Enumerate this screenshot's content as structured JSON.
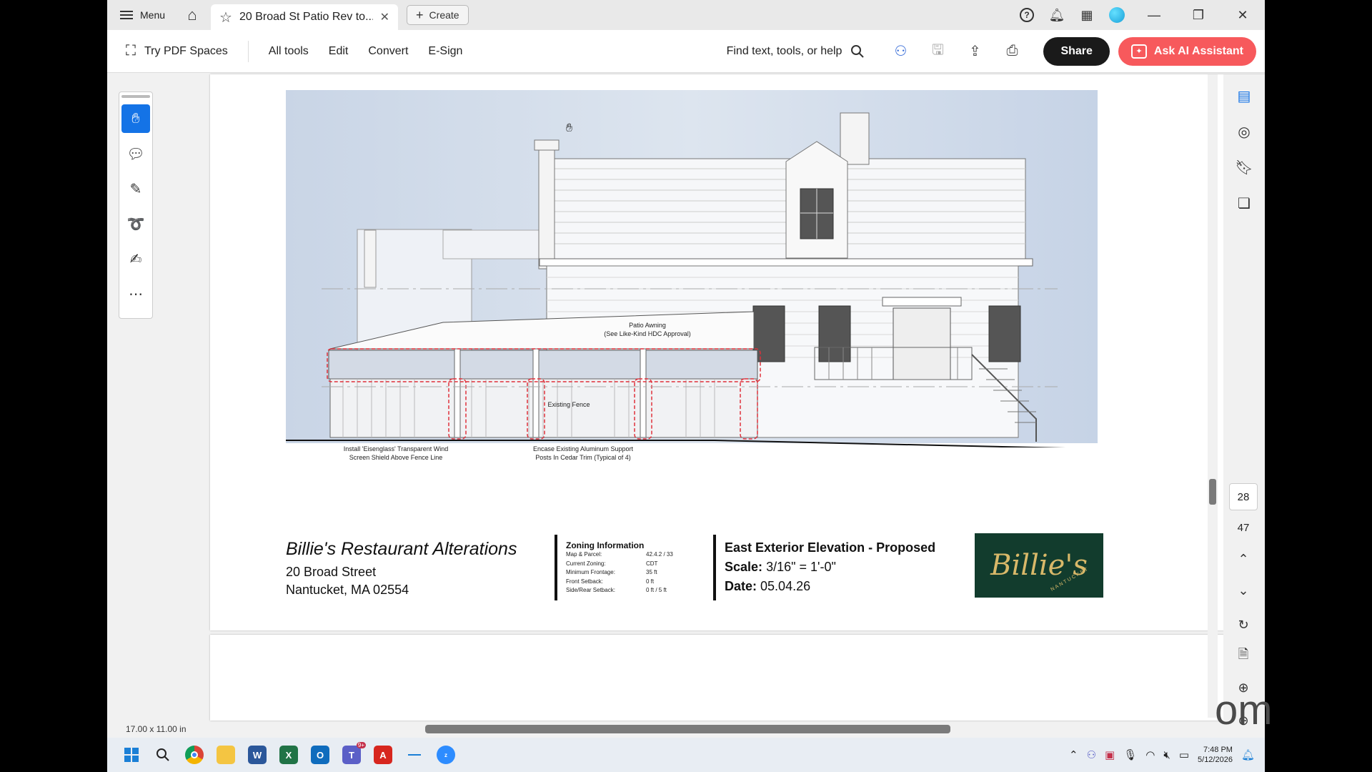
{
  "titlebar": {
    "menu_label": "Menu",
    "tab_title": "20 Broad St Patio Rev to...",
    "create_label": "Create"
  },
  "toolbar": {
    "try_pdf_spaces": "Try PDF Spaces",
    "menu": [
      "All tools",
      "Edit",
      "Convert",
      "E-Sign"
    ],
    "find_label": "Find text, tools, or help",
    "share_label": "Share",
    "ai_label": "Ask AI Assistant"
  },
  "drawing": {
    "label_awning_1": "Patio Awning",
    "label_awning_2": "(See Like-Kind HDC Approval)",
    "label_fence": "Existing Fence",
    "label_shield_1": "Install 'Eisenglass' Transparent Wind",
    "label_shield_2": "Screen Shield Above Fence Line",
    "label_posts_1": "Encase Existing Aluminum Support",
    "label_posts_2": "Posts In Cedar Trim (Typical of 4)"
  },
  "title_block": {
    "project_title": "Billie's Restaurant Alterations",
    "address_line1": "20 Broad Street",
    "address_line2": "Nantucket, MA 02554",
    "zoning_heading": "Zoning Information",
    "zoning_rows": [
      {
        "label": "Map & Parcel:",
        "value": "42.4.2 / 33"
      },
      {
        "label": "Current Zoning:",
        "value": "CDT"
      },
      {
        "label": "Minimum Frontage:",
        "value": "35 ft"
      },
      {
        "label": "Front Setback:",
        "value": "0 ft"
      },
      {
        "label": "Side/Rear Setback:",
        "value": "0 ft / 5 ft"
      }
    ],
    "sheet_title": "East Exterior Elevation - Proposed",
    "scale_label": "Scale:",
    "scale_value": "3/16\" = 1'-0\"",
    "date_label": "Date:",
    "date_value": "05.04.26",
    "logo_text": "Billie's",
    "logo_sub": "NANTUCKET"
  },
  "navigation": {
    "current_page": "28",
    "total_pages": "47"
  },
  "status": {
    "page_size": "17.00 x 11.00 in"
  },
  "taskbar": {
    "time": "7:48 PM",
    "date": "5/12/2026",
    "teams_badge": "9+"
  },
  "watermark": "om",
  "colors": {
    "share_bg": "#1a1a1a",
    "ai_bg": "#f7595c",
    "active_tool": "#1473e6",
    "logo_bg": "#123c2d",
    "logo_text": "#d8b869",
    "revision_cloud": "#e0303a"
  }
}
